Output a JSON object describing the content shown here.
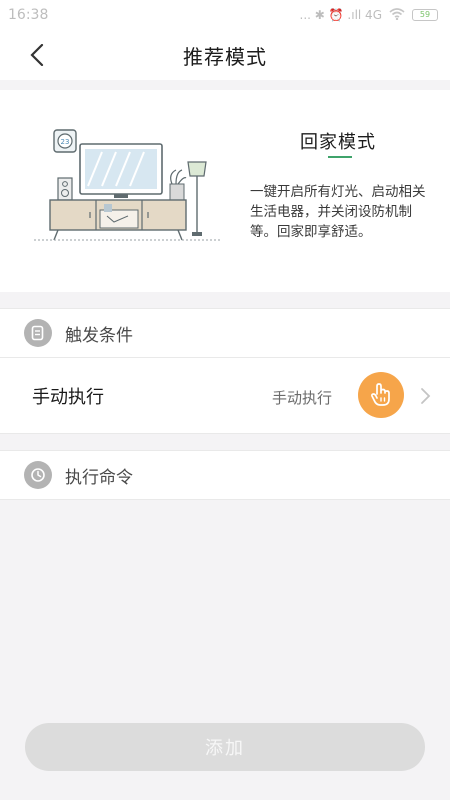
{
  "status_bar": {
    "time": "16:38",
    "indicators": "... ✱ ⏰ .ıll 4G",
    "battery": "59"
  },
  "header": {
    "title": "推荐模式",
    "back_icon": "chevron-left-icon"
  },
  "scene": {
    "name": "回家模式",
    "description": "一键开启所有灯光、启动相关生活电器，并关闭设防机制等。回家即享舒适。",
    "accent_color": "#3fa36b",
    "thermostat_label": "23"
  },
  "trigger": {
    "section_title": "触发条件",
    "section_icon": "document-icon",
    "row_label": "手动执行",
    "row_value": "手动执行",
    "badge_icon": "hand-tap-icon",
    "badge_color": "#f6a54a"
  },
  "command": {
    "section_title": "执行命令",
    "section_icon": "clock-icon"
  },
  "footer": {
    "add_label": "添加"
  }
}
